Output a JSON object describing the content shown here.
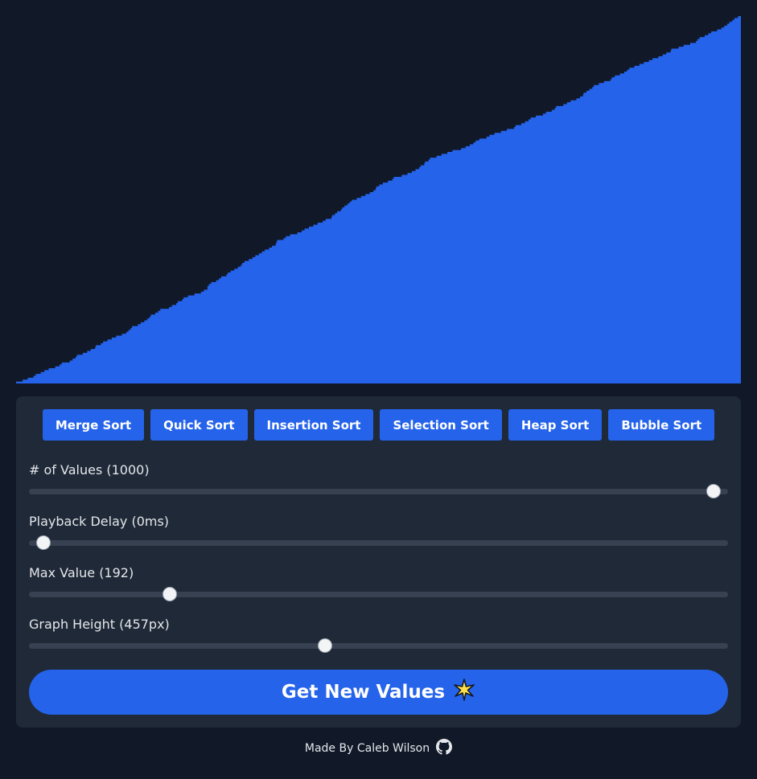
{
  "graph": {
    "value_count": 1000,
    "max_value": 192,
    "height_label": "457px",
    "bar_color": "#2563eb",
    "background_color": "#111827",
    "order": "sorted ascending"
  },
  "algorithms": [
    "Merge Sort",
    "Quick Sort",
    "Insertion Sort",
    "Selection Sort",
    "Heap Sort",
    "Bubble Sort"
  ],
  "sliders": [
    {
      "label": "# of Values (1000)",
      "level": 1.0
    },
    {
      "label": "Playback Delay (0ms)",
      "level": 0.0
    },
    {
      "label": "Max Value (192)",
      "level": 0.188
    },
    {
      "label": "Graph Height (457px)",
      "level": 0.42
    }
  ],
  "get_values_button": {
    "label": "Get New Values",
    "icon": "sparkle-icon"
  },
  "footer": {
    "text": "Made By Caleb Wilson",
    "icon": "github-icon"
  },
  "colors": {
    "accent": "#2563eb",
    "panel": "#1f2937",
    "track": "#374151",
    "page": "#111827"
  }
}
